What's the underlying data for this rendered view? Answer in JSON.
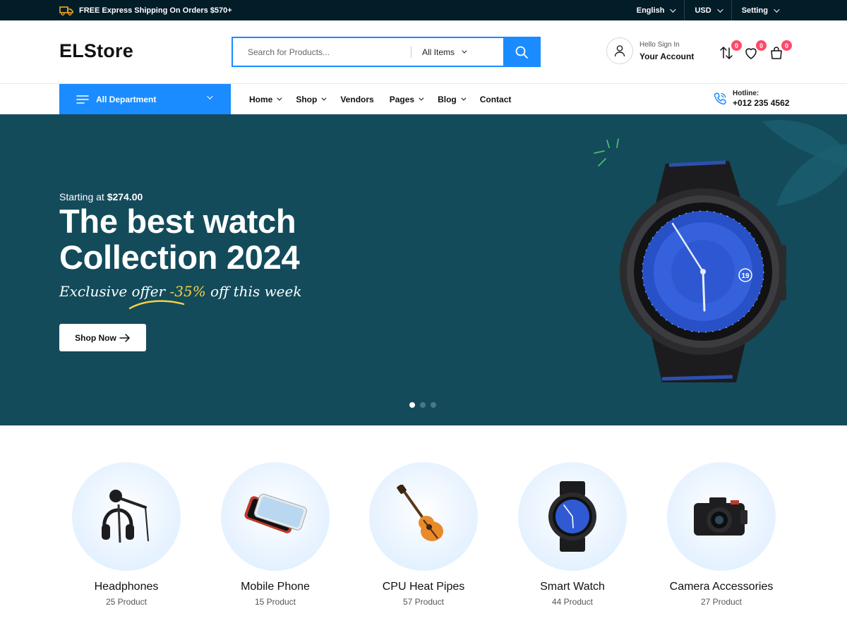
{
  "topbar": {
    "shipping": "FREE Express Shipping On Orders $570+",
    "language": "English",
    "currency": "USD",
    "setting": "Setting"
  },
  "header": {
    "logo": "ELStore",
    "search_placeholder": "Search for Products...",
    "search_category": "All Items",
    "account_greeting": "Hello Sign In",
    "account_label": "Your Account",
    "compare_count": "0",
    "wishlist_count": "0",
    "cart_count": "0"
  },
  "nav": {
    "department": "All Department",
    "links": [
      "Home",
      "Shop",
      "Vendors",
      "Pages",
      "Blog",
      "Contact"
    ],
    "hotline_label": "Hotline:",
    "hotline_number": "+012 235 4562"
  },
  "hero": {
    "starting_prefix": "Starting at ",
    "starting_price": "$274.00",
    "title_line1": "The best watch",
    "title_line2": "Collection 2024",
    "offer_prefix": "Exclusive offer ",
    "offer_discount": "-35%",
    "offer_suffix": " off this week",
    "button": "Shop Now"
  },
  "categories": [
    {
      "name": "Headphones",
      "count": "25 Product",
      "icon": "headphones-icon"
    },
    {
      "name": "Mobile Phone",
      "count": "15 Product",
      "icon": "mobile-phone-icon"
    },
    {
      "name": "CPU Heat Pipes",
      "count": "57 Product",
      "icon": "guitar-icon"
    },
    {
      "name": "Smart Watch",
      "count": "44 Product",
      "icon": "smart-watch-icon"
    },
    {
      "name": "Camera Accessories",
      "count": "27 Product",
      "icon": "camera-icon"
    }
  ],
  "colors": {
    "accent": "#1a8cff",
    "hero_bg": "#134b5b",
    "topbar_bg": "#021d28",
    "badge": "#ff4a6a",
    "offer_highlight": "#f5d142"
  }
}
